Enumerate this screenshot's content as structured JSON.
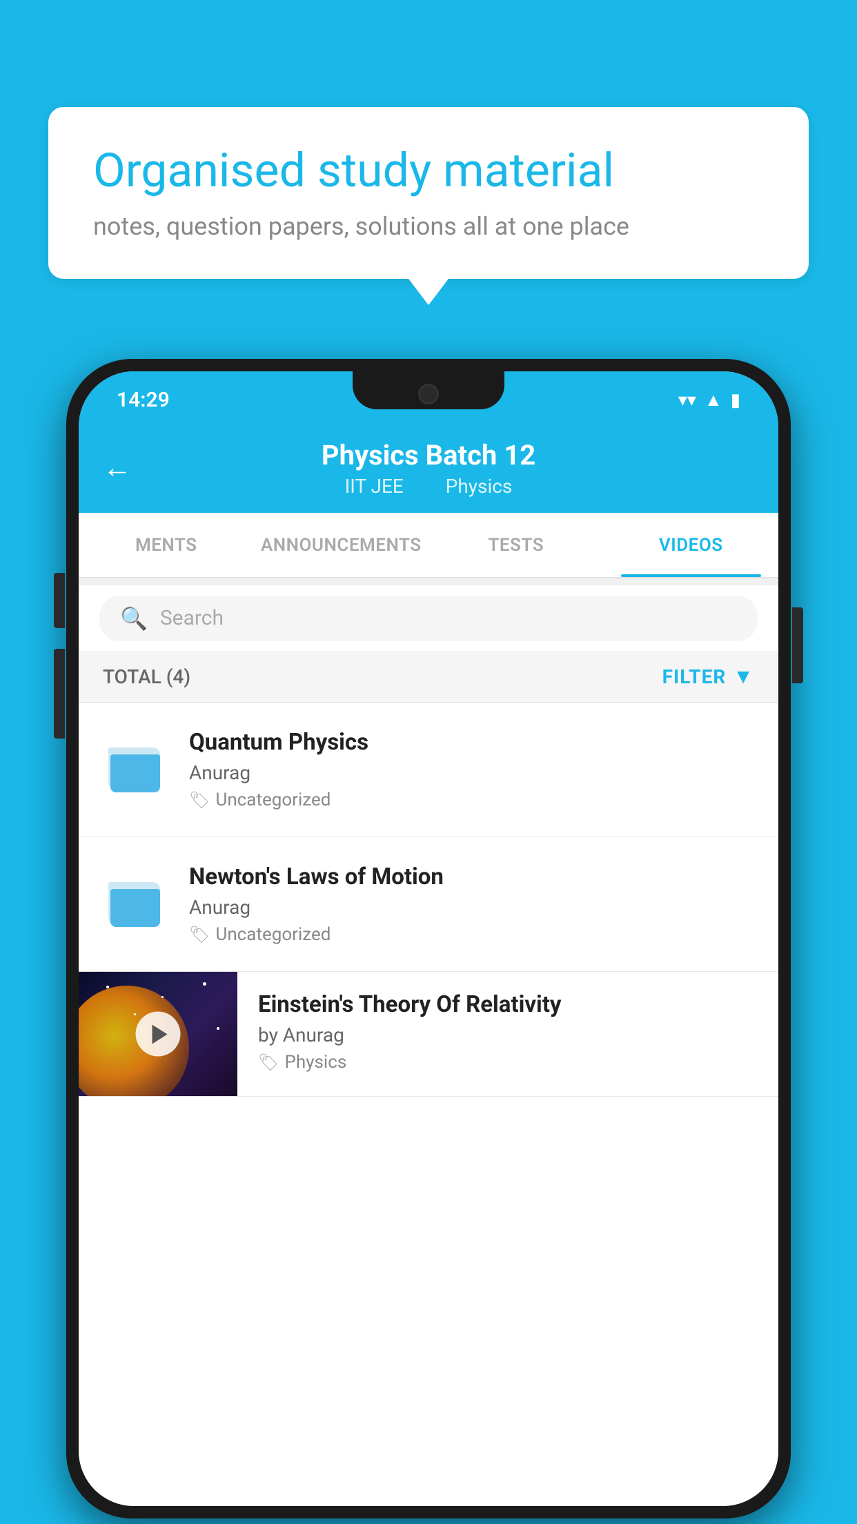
{
  "background_color": "#1ab8e8",
  "speech_bubble": {
    "title": "Organised study material",
    "subtitle": "notes, question papers, solutions all at one place"
  },
  "status_bar": {
    "time": "14:29",
    "wifi_icon": "wifi",
    "signal_icon": "signal",
    "battery_icon": "battery"
  },
  "app_header": {
    "title": "Physics Batch 12",
    "subtitle_part1": "IIT JEE",
    "subtitle_part2": "Physics",
    "back_icon": "←"
  },
  "tabs": [
    {
      "label": "MENTS",
      "active": false
    },
    {
      "label": "ANNOUNCEMENTS",
      "active": false
    },
    {
      "label": "TESTS",
      "active": false
    },
    {
      "label": "VIDEOS",
      "active": true
    }
  ],
  "search": {
    "placeholder": "Search"
  },
  "filter_row": {
    "total_label": "TOTAL (4)",
    "filter_label": "FILTER"
  },
  "list_items": [
    {
      "title": "Quantum Physics",
      "author": "Anurag",
      "tag": "Uncategorized",
      "type": "folder"
    },
    {
      "title": "Newton's Laws of Motion",
      "author": "Anurag",
      "tag": "Uncategorized",
      "type": "folder"
    },
    {
      "title": "Einstein's Theory Of Relativity",
      "author": "by Anurag",
      "tag": "Physics",
      "type": "video"
    }
  ],
  "icons": {
    "back": "←",
    "search": "🔍",
    "filter_funnel": "▼",
    "tag": "🏷",
    "play": "▶"
  }
}
